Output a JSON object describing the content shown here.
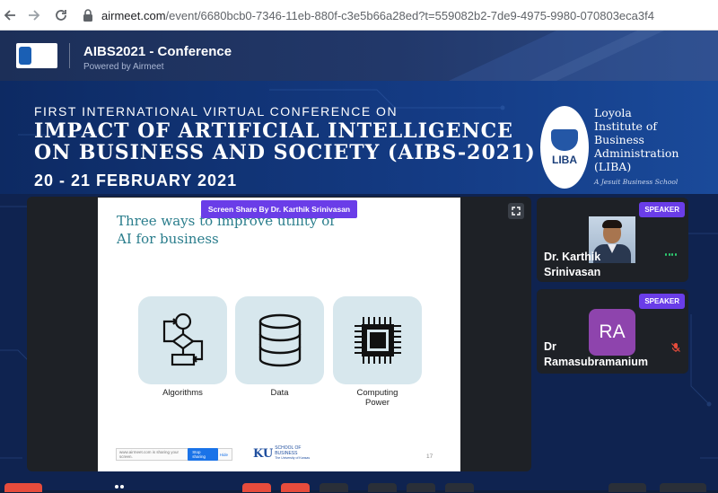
{
  "browser": {
    "url_host": "airmeet.com",
    "url_path": "/event/6680bcb0-7346-11eb-880f-c3e5b66a28ed?t=559082b2-7de9-4975-9980-070803eca3f4"
  },
  "header": {
    "title": "AIBS2021 - Conference",
    "subtitle": "Powered by Airmeet",
    "logo_text": "Loyola Institute of Business Administration"
  },
  "banner": {
    "line1": "FIRST INTERNATIONAL VIRTUAL CONFERENCE ON",
    "line2": "IMPACT OF ARTIFICIAL INTELLIGENCE",
    "line3": "ON BUSINESS AND SOCIETY (AIBS-2021)",
    "date": "20 - 21 FEBRUARY 2021",
    "institute_oval": "LIBA",
    "institute_name_1": "Loyola",
    "institute_name_2": "Institute of",
    "institute_name_3": "Business",
    "institute_name_4": "Administration",
    "institute_name_5": "(LIBA)",
    "institute_tagline": "A Jesuit Business School"
  },
  "screen_share": {
    "badge": "Screen Share By Dr. Karthik Srinivasan",
    "slide_title_1": "Three ways to improve utility of",
    "slide_title_2": "AI for business",
    "cards": [
      {
        "label": "Algorithms",
        "icon": "flowchart-icon"
      },
      {
        "label": "Data",
        "icon": "database-icon"
      },
      {
        "label": "Computing",
        "label2": "Power",
        "icon": "cpu-chip-icon"
      }
    ],
    "share_bar_text": "www.airmeet.com is sharing your screen.",
    "stop_label": "Stop sharing",
    "hide_label": "Hide",
    "ku_mark": "KU",
    "ku_text_1": "SCHOOL OF",
    "ku_text_2": "BUSINESS",
    "ku_text_3": "The University of Kansas",
    "page_number": "17"
  },
  "speakers": [
    {
      "badge": "SPEAKER",
      "name_1": "Dr. Karthik",
      "name_2": "Srinivasan",
      "audio": "active"
    },
    {
      "badge": "SPEAKER",
      "initials": "RA",
      "name_1": "Dr",
      "name_2": "Ramasubramanium",
      "audio": "muted"
    }
  ],
  "colors": {
    "accent_purple": "#6a3de8",
    "avatar_purple": "#8e44ad",
    "header_navy": "#1c2f58",
    "audio_green": "#2ecc71",
    "mute_red": "#e74c3c"
  }
}
